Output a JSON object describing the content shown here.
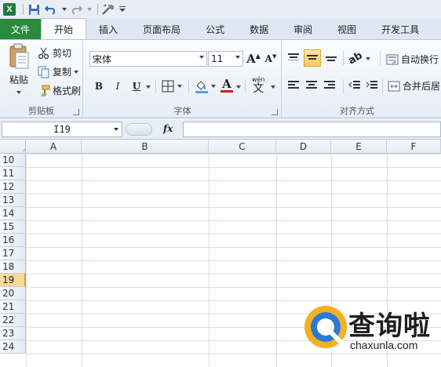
{
  "qat": {
    "app_icon": "X",
    "icons": [
      "save-icon",
      "undo-icon",
      "redo-icon",
      "customize-icon",
      "qat-menu-icon"
    ]
  },
  "tabs": [
    {
      "label": "文件",
      "name": "tab-file"
    },
    {
      "label": "开始",
      "name": "tab-home"
    },
    {
      "label": "插入",
      "name": "tab-insert"
    },
    {
      "label": "页面布局",
      "name": "tab-page-layout"
    },
    {
      "label": "公式",
      "name": "tab-formulas"
    },
    {
      "label": "数据",
      "name": "tab-data"
    },
    {
      "label": "审阅",
      "name": "tab-review"
    },
    {
      "label": "视图",
      "name": "tab-view"
    },
    {
      "label": "开发工具",
      "name": "tab-developer"
    }
  ],
  "clipboard": {
    "group_label": "剪贴板",
    "paste": "粘贴",
    "cut": "剪切",
    "copy": "复制",
    "format_painter": "格式刷"
  },
  "font": {
    "group_label": "字体",
    "font_name": "宋体",
    "font_size": "11",
    "grow": "A",
    "shrink": "A",
    "bold": "B",
    "italic": "I",
    "underline": "U",
    "font_color_letter": "A",
    "phonetic": "wén"
  },
  "alignment": {
    "group_label": "对齐方式",
    "wrap_text": "自动换行",
    "merge_center": "合并后居"
  },
  "formula_bar": {
    "name_box": "I19",
    "fx": "fx",
    "value": ""
  },
  "grid": {
    "columns": [
      "A",
      "B",
      "C",
      "D",
      "E",
      "F"
    ],
    "rows": [
      "10",
      "11",
      "12",
      "13",
      "14",
      "15",
      "16",
      "17",
      "18",
      "19",
      "20",
      "21",
      "22",
      "23",
      "24"
    ],
    "selected_row": "19"
  },
  "watermark": {
    "text": "查询啦",
    "url": "chaxunla.com"
  },
  "colors": {
    "file_tab": "#2b8a3e",
    "selected_row": "#f9d99a",
    "brand": "#2b79d6"
  }
}
